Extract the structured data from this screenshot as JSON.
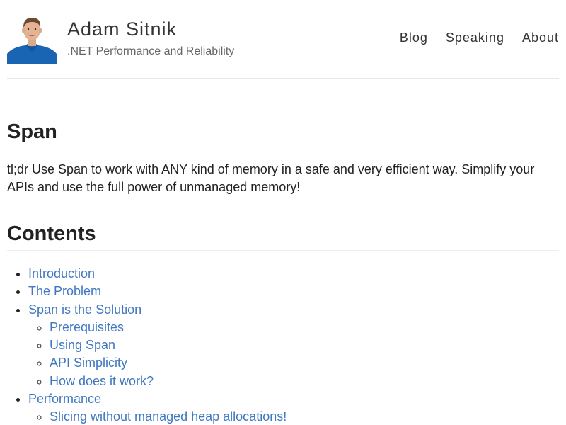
{
  "header": {
    "site_title": "Adam Sitnik",
    "subtitle": ".NET Performance and Reliability",
    "nav": [
      {
        "label": "Blog"
      },
      {
        "label": "Speaking"
      },
      {
        "label": "About"
      }
    ]
  },
  "post": {
    "title": "Span",
    "tldr": "tl;dr Use Span to work with ANY kind of memory in a safe and very efficient way. Simplify your APIs and use the full power of unmanaged memory!",
    "contents_heading": "Contents",
    "toc": [
      {
        "label": "Introduction"
      },
      {
        "label": "The Problem"
      },
      {
        "label": "Span is the Solution",
        "children": [
          {
            "label": "Prerequisites"
          },
          {
            "label": "Using Span"
          },
          {
            "label": "API Simplicity"
          },
          {
            "label": "How does it work?"
          }
        ]
      },
      {
        "label": "Performance",
        "children": [
          {
            "label": "Slicing without managed heap allocations!"
          }
        ]
      }
    ]
  },
  "colors": {
    "link": "#4078c0",
    "text": "#222222",
    "avatar_shirt": "#1a64b4"
  }
}
